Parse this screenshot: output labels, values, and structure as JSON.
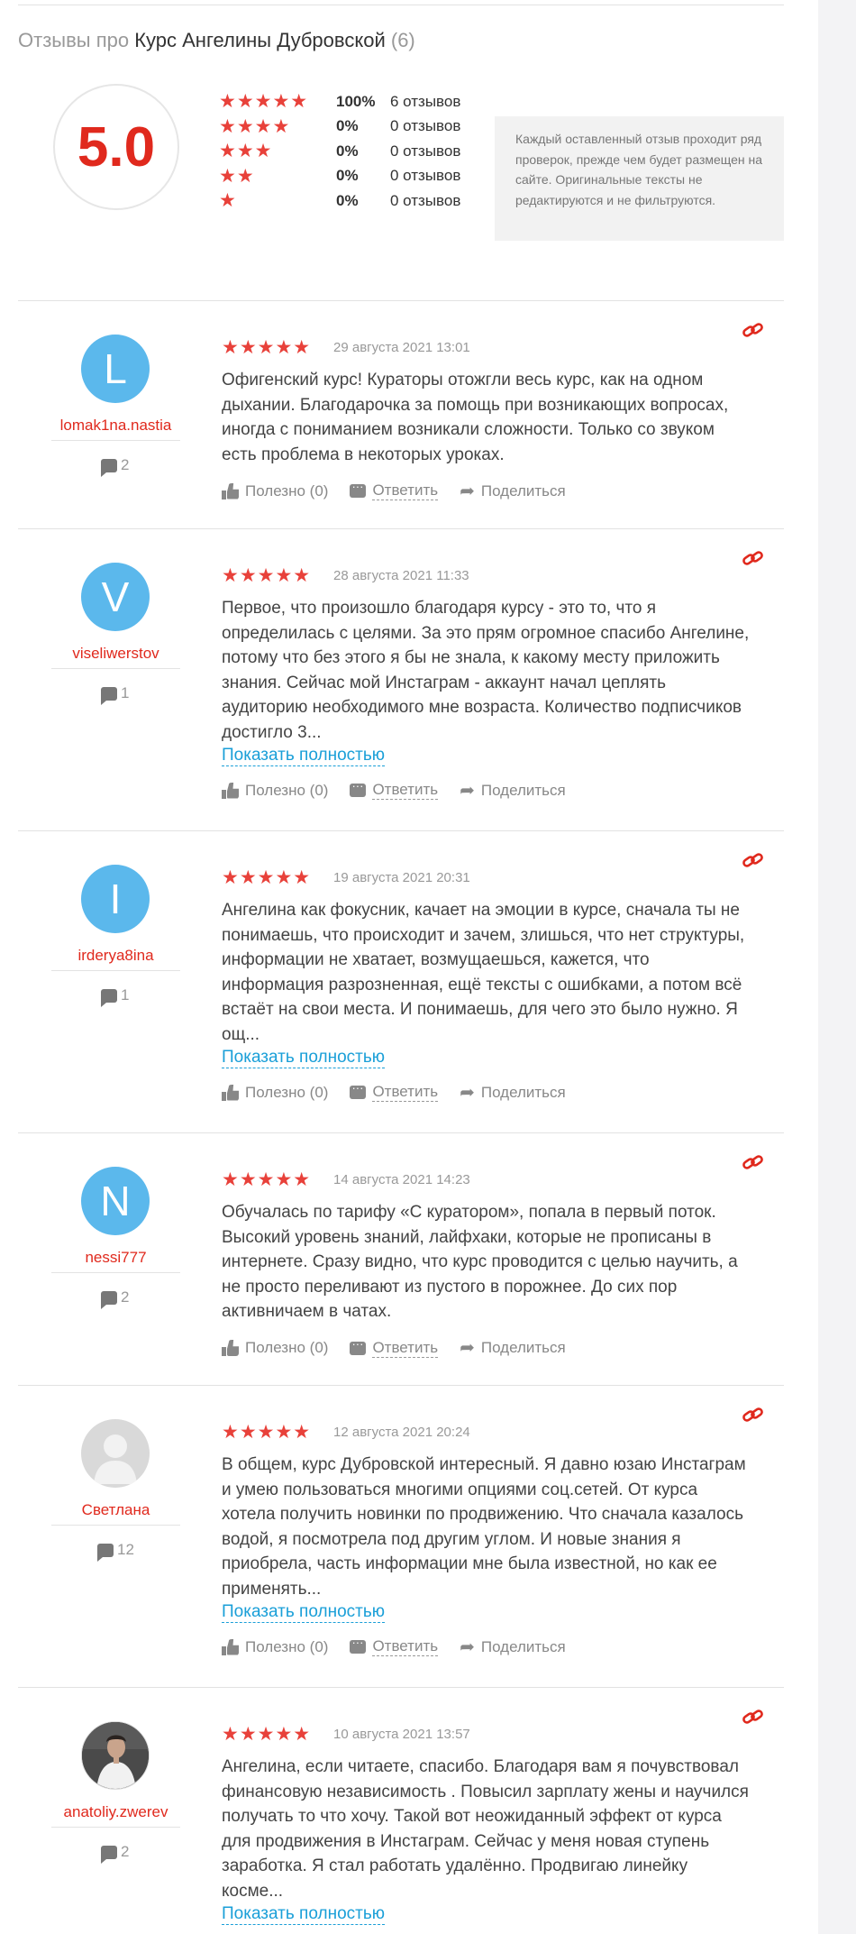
{
  "header": {
    "prefix": "Отзывы про",
    "course": "Курс Ангелины Дубровской",
    "count": "(6)"
  },
  "summary": {
    "score": "5.0",
    "distribution": [
      {
        "stars": "★★★★★",
        "level": 5,
        "percent": "100%",
        "count": "6 отзывов"
      },
      {
        "stars": "★★★★",
        "level": 4,
        "percent": "0%",
        "count": "0 отзывов"
      },
      {
        "stars": "★★★",
        "level": 3,
        "percent": "0%",
        "count": "0 отзывов"
      },
      {
        "stars": "★★",
        "level": 2,
        "percent": "0%",
        "count": "0 отзывов"
      },
      {
        "stars": "★",
        "level": 1,
        "percent": "0%",
        "count": "0 отзывов"
      }
    ],
    "notice": "Каждый оставленный отзыв проходит ряд проверок, прежде чем будет размещен на сайте. Оригинальные тексты не редактируются и не фильтруются."
  },
  "labels": {
    "stars": "★★★★★",
    "useful": "Полезно (0)",
    "reply": "Ответить",
    "share": "Поделиться",
    "show_full": "Показать полностью"
  },
  "colors": {
    "accent": "#e0291d",
    "star": "#e8413a",
    "link": "#1a9fd8",
    "avatar": "#5bb8ec"
  },
  "reviews": [
    {
      "avatar_letter": "L",
      "avatar_type": "letter",
      "user": "lomak1na.nastia",
      "review_count": "2",
      "rating": 5,
      "date": "29 августа 2021 13:01",
      "text": "Офигенский курс! Кураторы отожгли весь курс, как на одном дыхании. Благодарочка за помощь при возникающих вопросах, иногда с пониманием возникали сложности. Только со звуком есть проблема в некоторых уроках."
    },
    {
      "avatar_letter": "V",
      "avatar_type": "letter",
      "user": "viseliwerstov",
      "review_count": "1",
      "rating": 5,
      "date": "28 августа 2021 11:33",
      "text": "Первое, что произошло благодаря курсу - это то, что я определилась с целями. За это прям огромное спасибо Ангелине, потому что без этого я бы не знала, к какому месту приложить знания. Сейчас мой Инстаграм - аккаунт начал цеплять аудиторию необходимого мне возраста. Количество подписчиков достигло 3..."
    },
    {
      "avatar_letter": "I",
      "avatar_type": "letter",
      "user": "irderya8ina",
      "review_count": "1",
      "rating": 5,
      "date": "19 августа 2021 20:31",
      "text": "Ангелина как фокусник, качает на эмоции в курсе, сначала ты не понимаешь, что происходит и зачем, злишься, что нет структуры, информации не хватает, возмущаешься, кажется, что информация разрозненная, ещё тексты с ошибками, а потом всё встаёт на свои места. И понимаешь, для чего это было нужно. Я ощ..."
    },
    {
      "avatar_letter": "N",
      "avatar_type": "letter",
      "user": "nessi777",
      "review_count": "2",
      "rating": 5,
      "date": "14 августа 2021 14:23",
      "text": "Обучалась по тарифу «С куратором», попала в первый поток. Высокий уровень знаний, лайфхаки, которые не прописаны в интернете. Сразу видно, что курс проводится с целью научить, а не просто переливают из пустого в порожнее. До сих пор активничаем в чатах."
    },
    {
      "avatar_letter": "",
      "avatar_type": "ghost",
      "user": "Светлана",
      "review_count": "12",
      "rating": 5,
      "date": "12 августа 2021 20:24",
      "text": "В общем, курс Дубровской интересный. Я давно юзаю Инстаграм и умею пользоваться многими опциями соц.сетей. От курса хотела получить новинки по продвижению. Что сначала казалось водой, я посмотрела под другим углом. И новые знания я приобрела, часть информации мне была известной, но как ее применять..."
    },
    {
      "avatar_letter": "",
      "avatar_type": "photo",
      "user": "anatoliy.zwerev",
      "review_count": "2",
      "rating": 5,
      "date": "10 августа 2021 13:57",
      "text": "Ангелина, если читаете, спасибо. Благодаря вам я почувствовал финансовую независимость . Повысил зарплату жены и научился получать то что хочу. Такой вот неожиданный эффект от курса для продвижения в Инстаграм. Сейчас у меня новая ступень заработка. Я стал работать удалённо. Продвигаю линейку косме..."
    }
  ]
}
